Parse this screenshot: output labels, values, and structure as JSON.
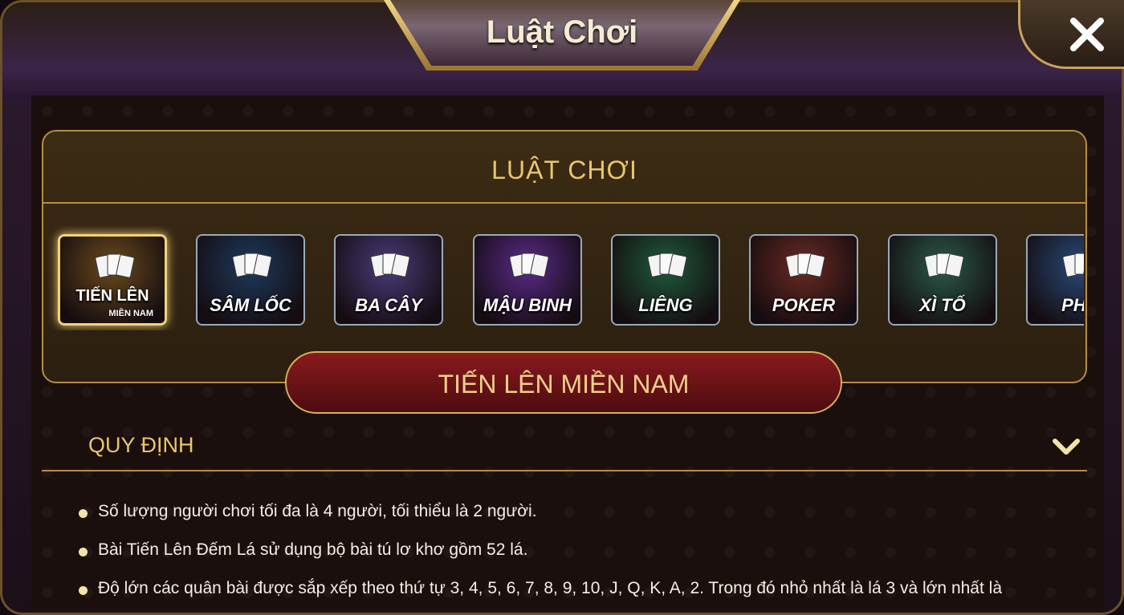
{
  "window": {
    "title": "Luật Chơi"
  },
  "panel": {
    "title": "LUẬT CHƠI"
  },
  "games": [
    {
      "label": "TIẾN LÊN",
      "sublabel": "MIỀN NAM",
      "selected": true,
      "color": "#6b4a1c"
    },
    {
      "label": "SÂM LỐC",
      "selected": false,
      "color": "#1d3a5c"
    },
    {
      "label": "BA CÂY",
      "selected": false,
      "color": "#4a3c7a"
    },
    {
      "label": "MẬU BINH",
      "selected": false,
      "color": "#5a2a8a"
    },
    {
      "label": "LIÊNG",
      "selected": false,
      "color": "#1f5a3a"
    },
    {
      "label": "POKER",
      "selected": false,
      "color": "#6a2a22"
    },
    {
      "label": "XÌ TỐ",
      "selected": false,
      "color": "#2a5a4a"
    },
    {
      "label": "PHỎ",
      "selected": false,
      "color": "#2a4a7a"
    }
  ],
  "selected_game": {
    "title": "TIẾN LÊN MIỀN NAM"
  },
  "rules": {
    "section_title": "QUY ĐỊNH",
    "items": [
      "Số lượng người chơi tối đa là 4 người, tối thiểu là 2 người.",
      "Bài Tiến Lên Đếm Lá sử dụng bộ bài tú lơ khơ gồm 52 lá.",
      "Độ lớn các quân bài được sắp xếp theo thứ tự 3, 4, 5, 6, 7, 8, 9, 10, J, Q, K, A, 2. Trong đó nhỏ nhất là lá 3 và lớn nhất là"
    ]
  }
}
